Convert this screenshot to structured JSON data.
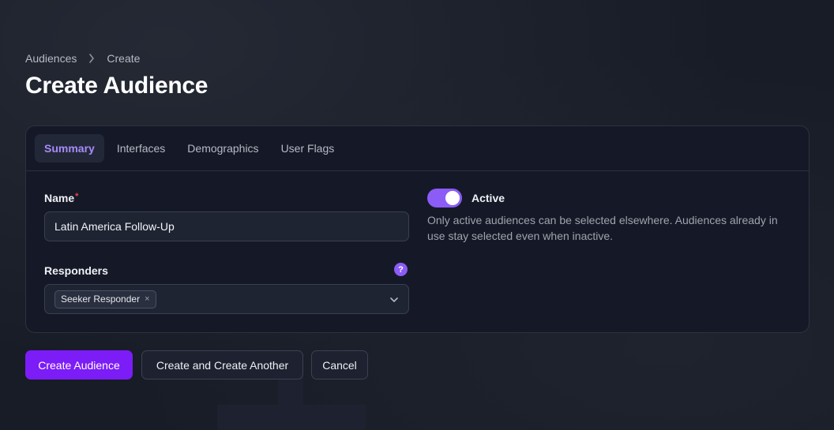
{
  "breadcrumb": {
    "items": [
      "Audiences",
      "Create"
    ],
    "separator_icon": "chevron-right-icon"
  },
  "page": {
    "title": "Create Audience"
  },
  "tabs": [
    {
      "label": "Summary",
      "active": true
    },
    {
      "label": "Interfaces",
      "active": false
    },
    {
      "label": "Demographics",
      "active": false
    },
    {
      "label": "User Flags",
      "active": false
    }
  ],
  "form": {
    "name": {
      "label": "Name",
      "required_marker": "*",
      "value": "Latin America Follow-Up"
    },
    "responders": {
      "label": "Responders",
      "help_icon": "question-circle-icon",
      "help_glyph": "?",
      "selected": [
        {
          "label": "Seeker Responder",
          "remove_glyph": "×"
        }
      ]
    },
    "active": {
      "label": "Active",
      "checked": true,
      "helper_text": "Only active audiences can be selected elsewhere. Audiences already in use stay selected even when inactive."
    }
  },
  "actions": {
    "create": "Create Audience",
    "create_another": "Create and Create Another",
    "cancel": "Cancel"
  },
  "colors": {
    "accent": "#8b5cf6",
    "primary_button": "#7c1cf7",
    "required": "#ef4444"
  }
}
